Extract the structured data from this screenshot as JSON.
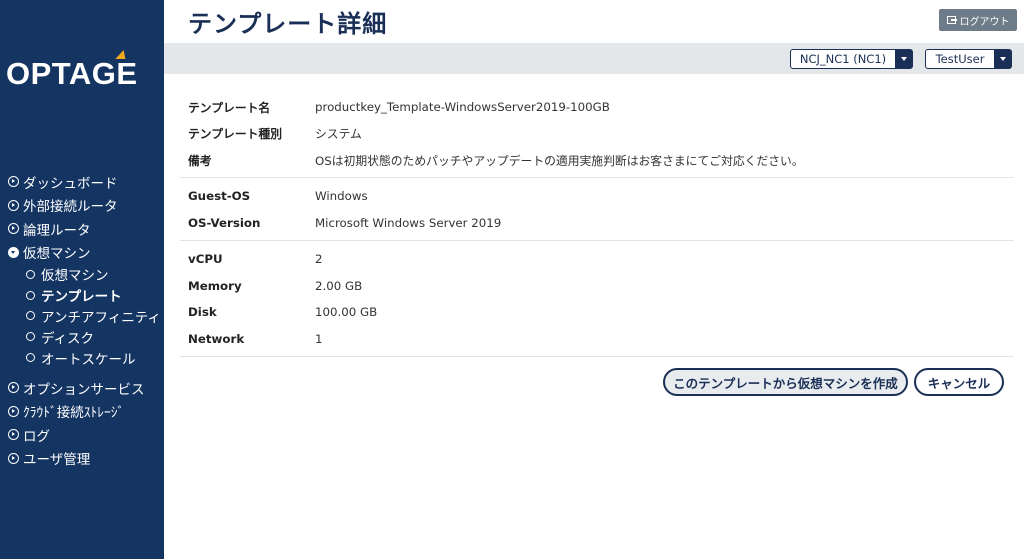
{
  "brand": {
    "logo_text": "OPTAGE",
    "accent_color": "#f3a81d"
  },
  "sidebar": {
    "items": [
      {
        "label": "ダッシュボード"
      },
      {
        "label": "外部接続ルータ"
      },
      {
        "label": "論理ルータ"
      },
      {
        "label": "仮想マシン",
        "open": true
      }
    ],
    "sub_items": [
      {
        "label": "仮想マシン"
      },
      {
        "label": "テンプレート",
        "active": true
      },
      {
        "label": "アンチアフィニティ"
      },
      {
        "label": "ディスク"
      },
      {
        "label": "オートスケール"
      }
    ],
    "items_after": [
      {
        "label": "オプションサービス"
      },
      {
        "label": "ｸﾗｳﾄﾞ接続ｽﾄﾚｰｼﾞ"
      },
      {
        "label": "ログ"
      },
      {
        "label": "ユーザ管理"
      }
    ]
  },
  "header": {
    "title": "テンプレート詳細",
    "logout_label": "ログアウト",
    "region_select": "NCJ_NC1 (NC1)",
    "user_select": "TestUser"
  },
  "details": {
    "template_name_label": "テンプレート名",
    "template_name": "productkey_Template-WindowsServer2019-100GB",
    "template_type_label": "テンプレート種別",
    "template_type": "システム",
    "remarks_label": "備考",
    "remarks": "OSは初期状態のためパッチやアップデートの適用実施判断はお客さまにてご対応ください。",
    "guest_os_label": "Guest-OS",
    "guest_os": "Windows",
    "os_version_label": "OS-Version",
    "os_version": "Microsoft Windows Server 2019",
    "vcpu_label": "vCPU",
    "vcpu": "2",
    "memory_label": "Memory",
    "memory": "2.00 GB",
    "disk_label": "Disk",
    "disk": "100.00 GB",
    "network_label": "Network",
    "network": "1"
  },
  "actions": {
    "create_vm_label": "このテンプレートから仮想マシンを作成",
    "cancel_label": "キャンセル"
  }
}
